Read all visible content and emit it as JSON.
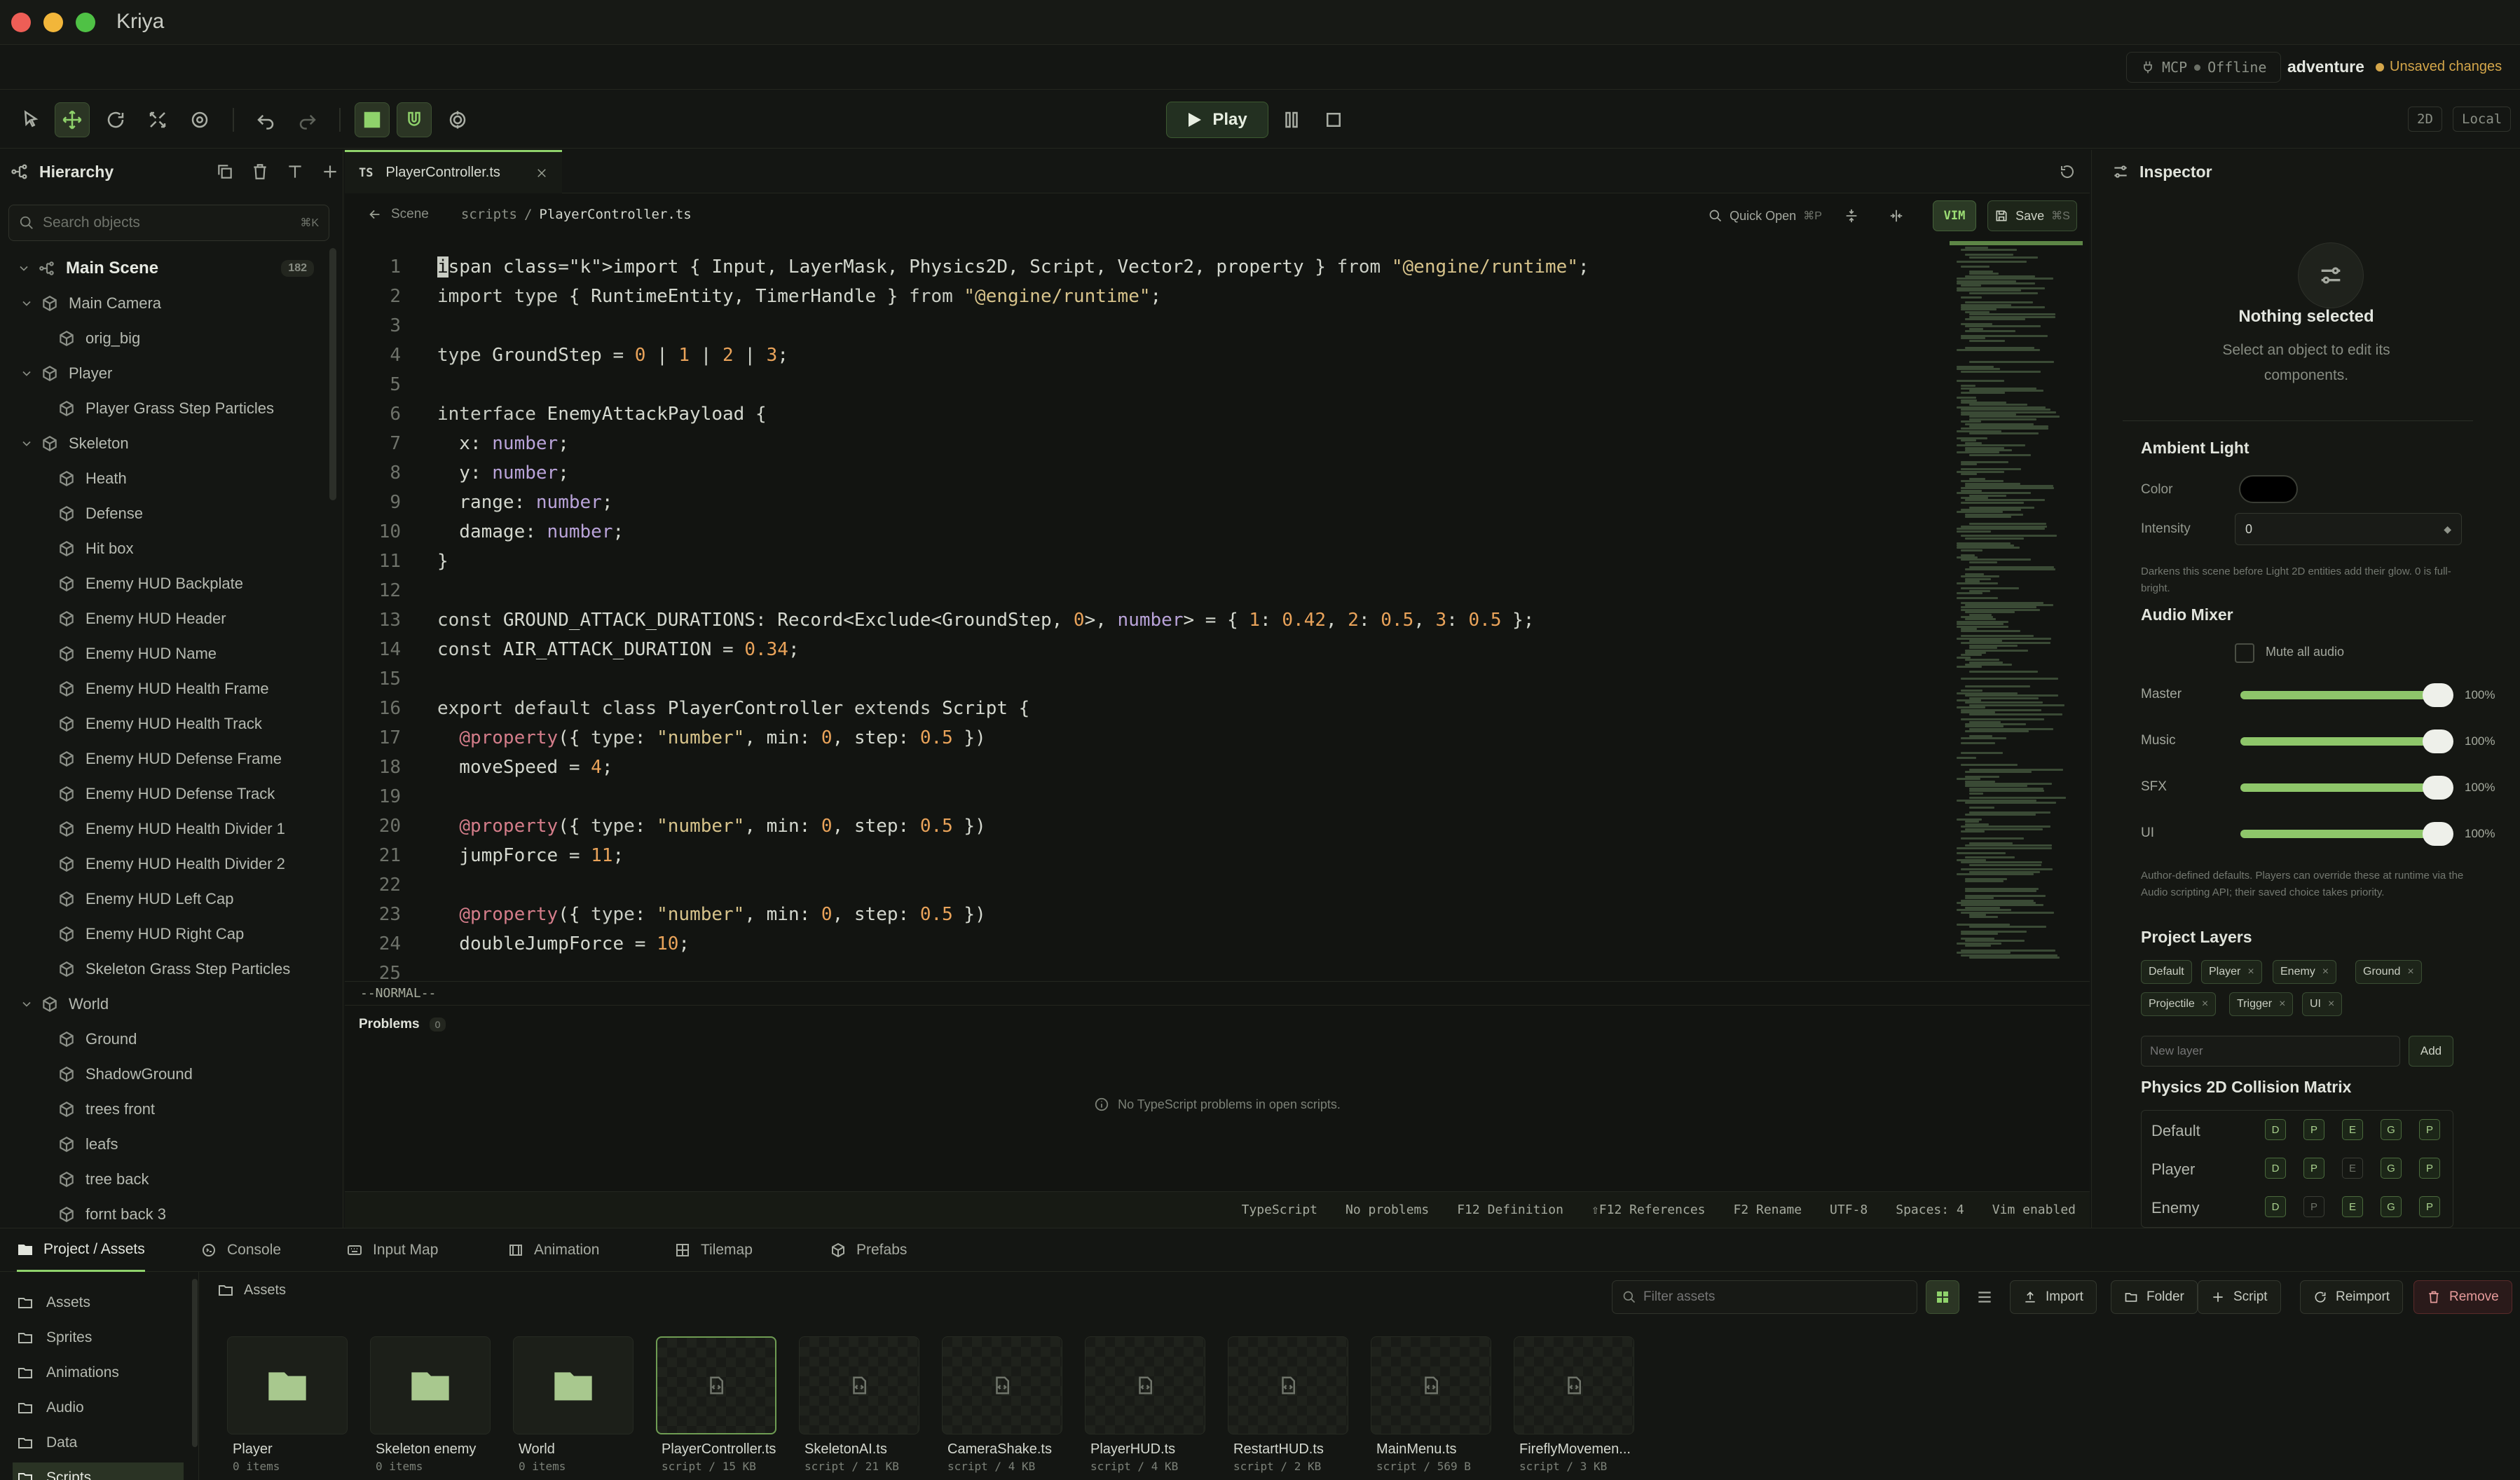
{
  "window": {
    "title": "Kriya"
  },
  "status": {
    "mcp_label": "MCP",
    "mcp_state": "Offline",
    "project": "adventure",
    "unsaved": "Unsaved changes"
  },
  "toolbar": {
    "play_label": "Play",
    "mode_2d": "2D",
    "space": "Local"
  },
  "hierarchy": {
    "title": "Hierarchy",
    "search_placeholder": "Search objects",
    "search_shortcut": "⌘K",
    "items": [
      {
        "label": "Main Scene",
        "depth": 0,
        "expanded": true,
        "root": true,
        "count": "182"
      },
      {
        "label": "Main Camera",
        "depth": 1,
        "expanded": true
      },
      {
        "label": "orig_big",
        "depth": 2
      },
      {
        "label": "Player",
        "depth": 1,
        "expanded": true
      },
      {
        "label": "Player Grass Step Particles",
        "depth": 2
      },
      {
        "label": "Skeleton",
        "depth": 1,
        "expanded": true
      },
      {
        "label": "Heath",
        "depth": 2
      },
      {
        "label": "Defense",
        "depth": 2
      },
      {
        "label": "Hit box",
        "depth": 2
      },
      {
        "label": "Enemy HUD Backplate",
        "depth": 2
      },
      {
        "label": "Enemy HUD Header",
        "depth": 2
      },
      {
        "label": "Enemy HUD Name",
        "depth": 2
      },
      {
        "label": "Enemy HUD Health Frame",
        "depth": 2
      },
      {
        "label": "Enemy HUD Health Track",
        "depth": 2
      },
      {
        "label": "Enemy HUD Defense Frame",
        "depth": 2
      },
      {
        "label": "Enemy HUD Defense Track",
        "depth": 2
      },
      {
        "label": "Enemy HUD Health Divider 1",
        "depth": 2
      },
      {
        "label": "Enemy HUD Health Divider 2",
        "depth": 2
      },
      {
        "label": "Enemy HUD Left Cap",
        "depth": 2
      },
      {
        "label": "Enemy HUD Right Cap",
        "depth": 2
      },
      {
        "label": "Skeleton Grass Step Particles",
        "depth": 2
      },
      {
        "label": "World",
        "depth": 1,
        "expanded": true
      },
      {
        "label": "Ground",
        "depth": 2
      },
      {
        "label": "ShadowGround",
        "depth": 2
      },
      {
        "label": "trees front",
        "depth": 2
      },
      {
        "label": "leafs",
        "depth": 2
      },
      {
        "label": "tree back",
        "depth": 2
      },
      {
        "label": "fornt back 3",
        "depth": 2
      }
    ]
  },
  "editor": {
    "tab": {
      "lang": "TS",
      "name": "PlayerController.ts"
    },
    "breadcrumb": {
      "back": "Scene",
      "folder": "scripts",
      "sep": "/",
      "file": "PlayerController.ts"
    },
    "quick_open": "Quick Open",
    "quick_open_kbd": "⌘P",
    "vim_label": "VIM",
    "save_label": "Save",
    "save_kbd": "⌘S",
    "lines": [
      "import { Input, LayerMask, Physics2D, Script, Vector2, property } from \"@engine/runtime\";",
      "import type { RuntimeEntity, TimerHandle } from \"@engine/runtime\";",
      "",
      "type GroundStep = 0 | 1 | 2 | 3;",
      "",
      "interface EnemyAttackPayload {",
      "  x: number;",
      "  y: number;",
      "  range: number;",
      "  damage: number;",
      "}",
      "",
      "const GROUND_ATTACK_DURATIONS: Record<Exclude<GroundStep, 0>, number> = { 1: 0.42, 2: 0.5, 3: 0.5 };",
      "const AIR_ATTACK_DURATION = 0.34;",
      "",
      "export default class PlayerController extends Script {",
      "  @property({ type: \"number\", min: 0, step: 0.5 })",
      "  moveSpeed = 4;",
      "",
      "  @property({ type: \"number\", min: 0, step: 0.5 })",
      "  jumpForce = 11;",
      "",
      "  @property({ type: \"number\", min: 0, step: 0.5 })",
      "  doubleJumpForce = 10;",
      ""
    ],
    "mode": "--NORMAL--",
    "problems_title": "Problems",
    "problems_count": "0",
    "problems_empty": "No TypeScript problems in open scripts.",
    "statusbar": [
      "TypeScript",
      "No problems",
      "F12 Definition",
      "⇧F12 References",
      "F2 Rename",
      "UTF-8",
      "Spaces: 4",
      "Vim enabled"
    ]
  },
  "inspector": {
    "title": "Inspector",
    "nothing_title": "Nothing selected",
    "nothing_desc": "Select an object to edit its components.",
    "ambient": {
      "title": "Ambient Light",
      "color_label": "Color",
      "color": "#000000",
      "intensity_label": "Intensity",
      "intensity": "0",
      "help": "Darkens this scene before Light 2D entities add their glow. 0 is full-bright."
    },
    "audio": {
      "title": "Audio Mixer",
      "mute_label": "Mute all audio",
      "channels": [
        {
          "name": "Master",
          "value": "100%",
          "level": 1.0
        },
        {
          "name": "Music",
          "value": "100%",
          "level": 1.0
        },
        {
          "name": "SFX",
          "value": "100%",
          "level": 1.0
        },
        {
          "name": "UI",
          "value": "100%",
          "level": 1.0
        }
      ],
      "help": "Author-defined defaults. Players can override these at runtime via the Audio scripting API; their saved choice takes priority."
    },
    "layers": {
      "title": "Project Layers",
      "items": [
        "Default",
        "Player",
        "Enemy",
        "Ground",
        "Projectile",
        "Trigger",
        "UI"
      ],
      "new_placeholder": "New layer",
      "add_label": "Add"
    },
    "matrix": {
      "title": "Physics 2D Collision Matrix",
      "rows": [
        "Default",
        "Player",
        "Enemy"
      ],
      "cols": [
        "D",
        "P",
        "E",
        "G",
        "P"
      ]
    }
  },
  "bottom": {
    "tabs": [
      "Project / Assets",
      "Console",
      "Input Map",
      "Animation",
      "Tilemap",
      "Prefabs"
    ],
    "folders": [
      "Assets",
      "Sprites",
      "Animations",
      "Audio",
      "Data",
      "Scripts"
    ],
    "path": "Assets",
    "filter_placeholder": "Filter assets",
    "actions": [
      "Import",
      "Folder",
      "Script",
      "Reimport",
      "Remove"
    ],
    "assets": [
      {
        "name": "Player",
        "meta": "0 items",
        "kind": "folder"
      },
      {
        "name": "Skeleton enemy",
        "meta": "0 items",
        "kind": "folder"
      },
      {
        "name": "World",
        "meta": "0 items",
        "kind": "folder"
      },
      {
        "name": "PlayerController.ts",
        "meta": "script / 15 KB",
        "kind": "script",
        "selected": true
      },
      {
        "name": "SkeletonAI.ts",
        "meta": "script / 21 KB",
        "kind": "script"
      },
      {
        "name": "CameraShake.ts",
        "meta": "script / 4 KB",
        "kind": "script"
      },
      {
        "name": "PlayerHUD.ts",
        "meta": "script / 4 KB",
        "kind": "script"
      },
      {
        "name": "RestartHUD.ts",
        "meta": "script / 2 KB",
        "kind": "script"
      },
      {
        "name": "MainMenu.ts",
        "meta": "script / 569 B",
        "kind": "script"
      },
      {
        "name": "FireflyMovemen...",
        "meta": "script / 3 KB",
        "kind": "script"
      }
    ]
  },
  "colors": {
    "accent": "#8fd26b",
    "warning": "#d4a64a",
    "close": "#ee5e56",
    "minimize": "#f2b63a",
    "maximize": "#4fc145"
  }
}
